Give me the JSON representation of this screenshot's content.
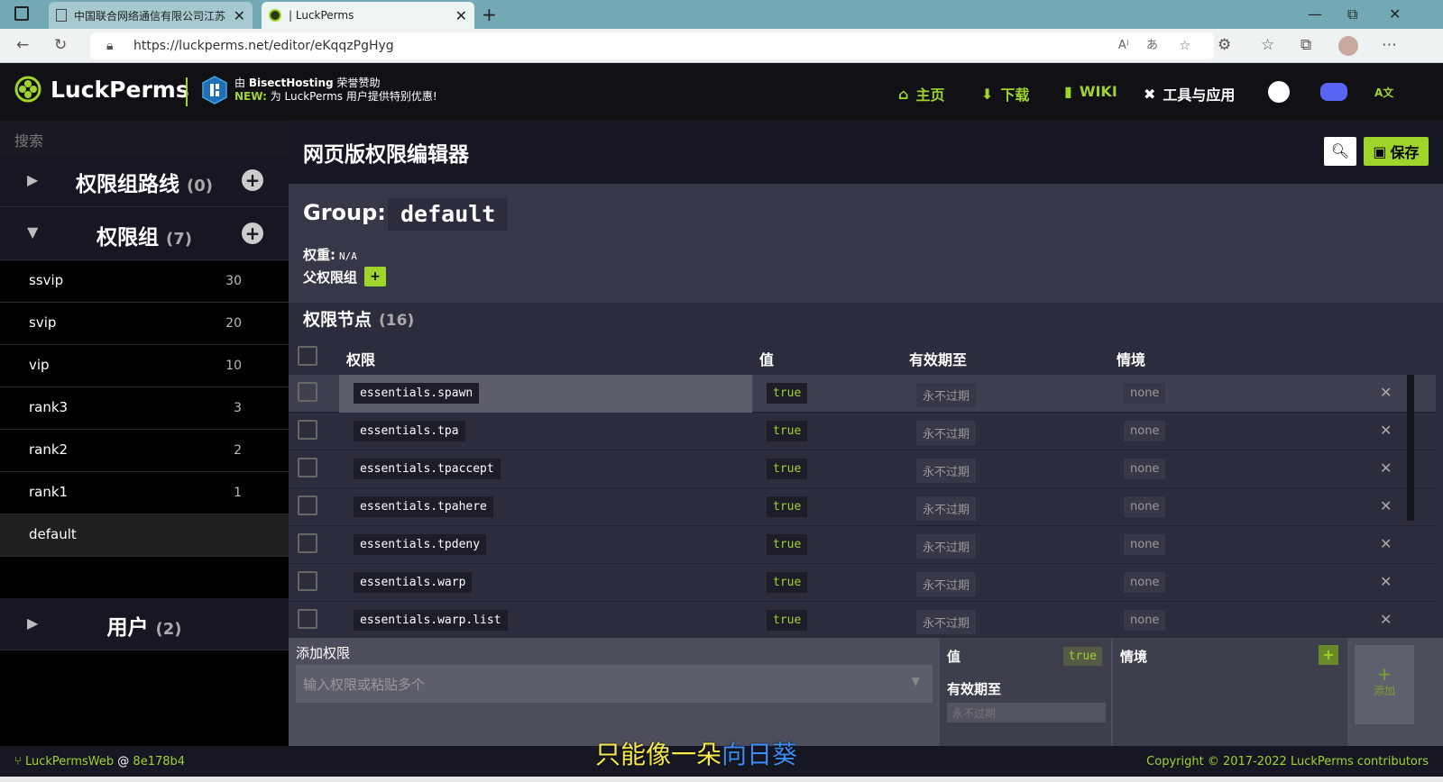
{
  "browser": {
    "tabs": [
      {
        "title": "中国联合网络通信有限公司江苏",
        "close": "✕"
      },
      {
        "title": "| LuckPerms",
        "close": "✕"
      }
    ],
    "new_tab": "+",
    "url": "https://luckperms.net/editor/eKqqzPgHyg",
    "window_controls": {
      "minimize": "—",
      "maximize": "⧉",
      "close": "✕"
    },
    "nav_icons": [
      "back-arrow-icon",
      "refresh-icon",
      "lock-icon",
      "read-aloud-icon",
      "translate-icon",
      "favorite-icon",
      "extensions-icon",
      "favorites-icon",
      "collections-icon",
      "profile-icon",
      "more-icon"
    ]
  },
  "header": {
    "logo_text": "LuckPerms",
    "sponsor_line1_prefix": "由 ",
    "sponsor_name": "BisectHosting",
    "sponsor_line1_suffix": " 荣誉赞助",
    "sponsor_new": "NEW:",
    "sponsor_line2": " 为 LuckPerms 用户提供特别优惠!",
    "nav": [
      {
        "label": "主页",
        "icon": "home-icon"
      },
      {
        "label": "下载",
        "icon": "download-icon"
      },
      {
        "label": "WIKI",
        "icon": "book-icon"
      },
      {
        "label": "工具与应用",
        "icon": "tools-icon"
      }
    ],
    "accent": "#9fd42a"
  },
  "sidebar": {
    "search_placeholder": "搜索",
    "tracks": {
      "label": "权限组路线",
      "count": "(0)"
    },
    "groups": {
      "label": "权限组",
      "count": "(7)",
      "items": [
        {
          "name": "ssvip",
          "weight": "30"
        },
        {
          "name": "svip",
          "weight": "20"
        },
        {
          "name": "vip",
          "weight": "10"
        },
        {
          "name": "rank3",
          "weight": "3"
        },
        {
          "name": "rank2",
          "weight": "2"
        },
        {
          "name": "rank1",
          "weight": "1"
        },
        {
          "name": "default",
          "weight": ""
        }
      ]
    },
    "users": {
      "label": "用户",
      "count": "(2)"
    }
  },
  "main": {
    "title": "网页版权限编辑器",
    "save_label": "保存",
    "group_label": "Group:",
    "group_name": "default",
    "weight_label": "权重:",
    "weight_value": "N/A",
    "parent_label": "父权限组",
    "parent_add": "+",
    "nodes_label": "权限节点",
    "nodes_count": "(16)",
    "columns": [
      "权限",
      "值",
      "有效期至",
      "情境"
    ],
    "rows": [
      {
        "permission": "essentials.spawn",
        "value": "true",
        "expiry": "永不过期",
        "context": "none"
      },
      {
        "permission": "essentials.tpa",
        "value": "true",
        "expiry": "永不过期",
        "context": "none"
      },
      {
        "permission": "essentials.tpaccept",
        "value": "true",
        "expiry": "永不过期",
        "context": "none"
      },
      {
        "permission": "essentials.tpahere",
        "value": "true",
        "expiry": "永不过期",
        "context": "none"
      },
      {
        "permission": "essentials.tpdeny",
        "value": "true",
        "expiry": "永不过期",
        "context": "none"
      },
      {
        "permission": "essentials.warp",
        "value": "true",
        "expiry": "永不过期",
        "context": "none"
      },
      {
        "permission": "essentials.warp.list",
        "value": "true",
        "expiry": "永不过期",
        "context": "none"
      }
    ],
    "add": {
      "label": "添加权限",
      "placeholder": "输入权限或粘贴多个",
      "value_label": "值",
      "value": "true",
      "expiry_label": "有效期至",
      "expiry_placeholder": "永不过期",
      "context_label": "情境",
      "context_add": "+",
      "button_plus": "+",
      "button_label": "添加"
    }
  },
  "footer": {
    "left_app": "LuckPermsWeb",
    "left_at": " @ ",
    "left_commit": "8e178b4",
    "right": "Copyright © 2017-2022 LuckPerms contributors"
  },
  "subtitle": {
    "part1": "只能像一朵",
    "part2": "向日葵"
  }
}
